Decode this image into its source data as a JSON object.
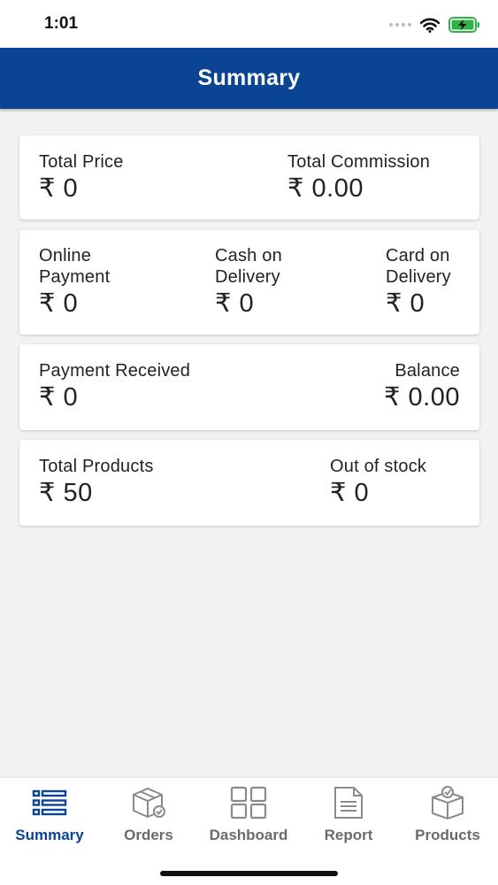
{
  "status_bar": {
    "time": "1:01"
  },
  "header": {
    "title": "Summary"
  },
  "cards": {
    "totals": {
      "total_price_label": "Total Price",
      "total_price_value": "₹ 0",
      "total_commission_label": "Total Commission",
      "total_commission_value": "₹ 0.00"
    },
    "payments": {
      "online_label_1": "Online",
      "online_label_2": "Payment",
      "online_value": "₹ 0",
      "cod_label_1": "Cash on",
      "cod_label_2": "Delivery",
      "cod_value": "₹ 0",
      "card_label_1": "Card on",
      "card_label_2": "Delivery",
      "card_value": "₹ 0"
    },
    "received": {
      "payment_received_label": "Payment Received",
      "payment_received_value": "₹ 0",
      "balance_label": "Balance",
      "balance_value": "₹ 0.00"
    },
    "products": {
      "total_products_label": "Total Products",
      "total_products_value": "₹ 50",
      "out_of_stock_label": "Out of stock",
      "out_of_stock_value": "₹ 0"
    }
  },
  "tabs": [
    {
      "label": "Summary",
      "icon": "list-icon",
      "active": true
    },
    {
      "label": "Orders",
      "icon": "box-check-icon",
      "active": false
    },
    {
      "label": "Dashboard",
      "icon": "grid-icon",
      "active": false
    },
    {
      "label": "Report",
      "icon": "document-icon",
      "active": false
    },
    {
      "label": "Products",
      "icon": "package-icon",
      "active": false
    }
  ],
  "colors": {
    "primary": "#0c4494",
    "background": "#f2f2f2",
    "tab_inactive": "#6b6b6b"
  }
}
